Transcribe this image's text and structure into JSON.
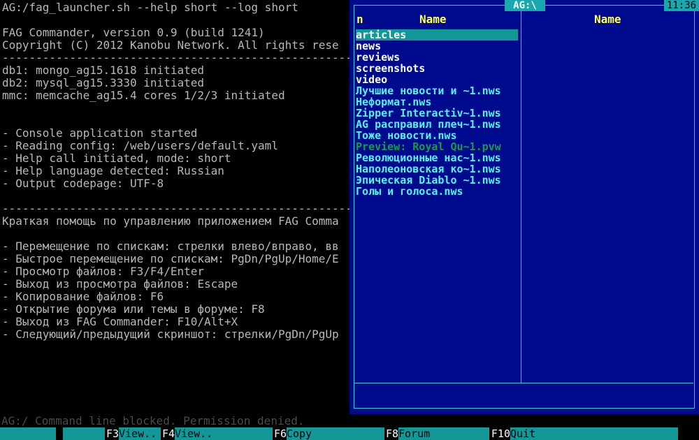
{
  "console": {
    "lines": [
      "AG:/fag_launcher.sh --help short --log short",
      "",
      "FAG Commander, version 0.9 (build 1241)",
      "Copyright (C) 2012 Kanobu Network. All rights rese",
      "-------------------------------------------------------",
      "db1: mongo_ag15.1618 initiated",
      "db2: mysql_ag15.3330 initiated",
      "mmc: memcache_ag15.4 cores 1/2/3 initiated",
      "",
      "",
      "- Console application started",
      "- Reading config: /web/users/default.yaml",
      "- Help call initiated, mode: short",
      "- Help language detected: Russian",
      "- Output codepage: UTF-8",
      "",
      "-------------------------------------------------------",
      "Краткая помощь по управлению приложением FAG Comma",
      "",
      "- Перемещение по спискам: стрелки влево/вправо, вв",
      "- Быстрое перемещение по спискам: PgDn/PgUp/Home/E",
      "- Просмотр файлов: F3/F4/Enter",
      "- Выход из просмотра файлов: Escape",
      "- Копирование файлов: F6",
      "- Открытие форума или темы в форуме: F8",
      "- Выход из FAG Commander: F10/Alt+X",
      "- Следующий/предыдущий скриншот: стрелки/PgDn/PgUp"
    ],
    "prompt": "AG:/ Command line blocked. Permission denied."
  },
  "panel": {
    "path": "AG:\\",
    "clock": "11:36",
    "left_col_marker": "n",
    "left_col_title": "Name",
    "right_col_title": "Name",
    "files": [
      {
        "name": "articles",
        "kind": "dir",
        "selected": true
      },
      {
        "name": "news",
        "kind": "dir"
      },
      {
        "name": "reviews",
        "kind": "dir"
      },
      {
        "name": "screenshots",
        "kind": "dir"
      },
      {
        "name": "video",
        "kind": "dir"
      },
      {
        "name": "Лучшие новости и ~1.nws",
        "kind": "file"
      },
      {
        "name": "Неформат.nws",
        "kind": "file"
      },
      {
        "name": "Zipper Interactiv~1.nws",
        "kind": "file"
      },
      {
        "name": "AG расправил плеч~1.nws",
        "kind": "file"
      },
      {
        "name": "Тоже новости.nws",
        "kind": "file"
      },
      {
        "name": "Preview: Royal Qu~1.pvw",
        "kind": "dim"
      },
      {
        "name": "Революционные нас~1.nws",
        "kind": "file"
      },
      {
        "name": "Наполеоновская ко~1.nws",
        "kind": "file"
      },
      {
        "name": "Эпическая Diablo ~1.nws",
        "kind": "file"
      },
      {
        "name": "Голы и голоса.nws",
        "kind": "file"
      }
    ]
  },
  "fkeys": [
    {
      "num": "",
      "label": ""
    },
    {
      "num": "",
      "label": ""
    },
    {
      "num": "F3",
      "label": "View.."
    },
    {
      "num": "F4",
      "label": "View.."
    },
    {
      "num": "",
      "label": ""
    },
    {
      "num": "F6",
      "label": "Copy"
    },
    {
      "num": "",
      "label": ""
    },
    {
      "num": "F8",
      "label": "Forum"
    },
    {
      "num": "",
      "label": ""
    },
    {
      "num": "F10",
      "label": "Quit"
    },
    {
      "num": "",
      "label": ""
    },
    {
      "num": "",
      "label": ""
    }
  ],
  "colors": {
    "panel_bg": "#000a8c",
    "frame": "#38c8d8",
    "highlight": "#139898",
    "header_text": "#ffff54"
  }
}
